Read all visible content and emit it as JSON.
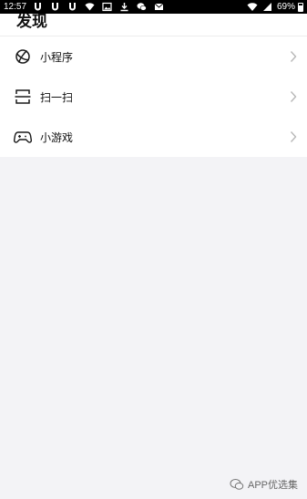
{
  "status_bar": {
    "time": "12:57",
    "battery": "69%",
    "left_icons": [
      "u-shield-icon",
      "u-shield-icon",
      "u-shield-icon",
      "signal-app-icon",
      "image-icon",
      "download-icon",
      "wechat-icon",
      "mail-icon"
    ],
    "right_icons": [
      "wifi-icon",
      "cellular-signal-icon",
      "battery-icon"
    ]
  },
  "header": {
    "title": "发现"
  },
  "menu": {
    "items": [
      {
        "label": "小程序",
        "icon": "mini-program-icon"
      },
      {
        "label": "扫一扫",
        "icon": "scan-icon"
      },
      {
        "label": "小游戏",
        "icon": "gamepad-icon"
      }
    ]
  },
  "watermark": {
    "text": "APP优选集"
  },
  "colors": {
    "background": "#f3f3f6",
    "surface": "#ffffff",
    "status_bar": "#000000",
    "chevron": "#b8b8b8"
  }
}
